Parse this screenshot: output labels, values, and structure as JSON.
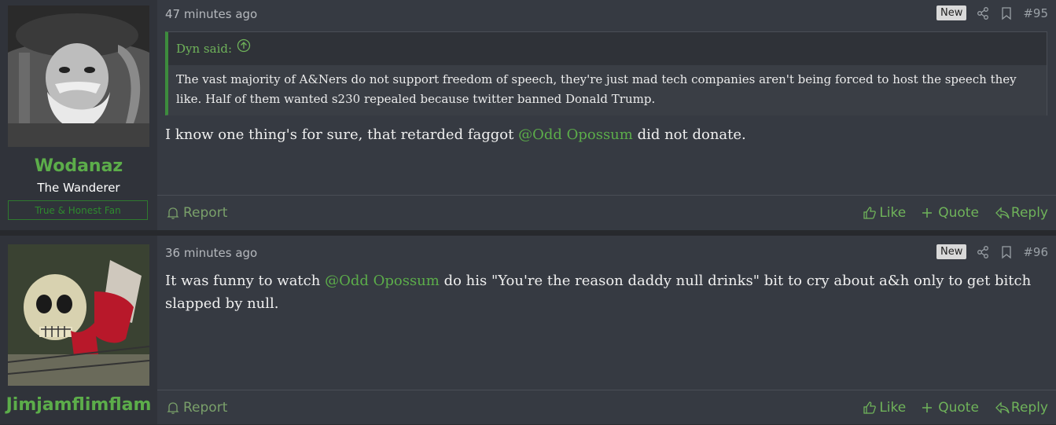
{
  "posts": [
    {
      "username": "Wodanaz",
      "user_title": "The Wanderer",
      "user_badge": "True & Honest Fan",
      "time": "47 minutes ago",
      "new_label": "New",
      "post_number": "#95",
      "quote": {
        "author": "Dyn said:",
        "text": "The vast majority of A&Ners do not support freedom of speech, they're just mad tech companies aren't being forced to host the speech they like. Half of them wanted s230 repealed because twitter banned Donald Trump."
      },
      "body_before": "I know one thing's for sure, that retarded faggot ",
      "mention": "@Odd Opossum",
      "body_after": " did not donate.",
      "report_label": "Report",
      "like_label": "Like",
      "quote_label": "Quote",
      "reply_label": "Reply"
    },
    {
      "username": "Jimjamflimflam",
      "time": "36 minutes ago",
      "new_label": "New",
      "post_number": "#96",
      "body_before": "It was funny to watch ",
      "mention": "@Odd Opossum",
      "body_after": " do his \"You're the reason daddy null drinks\" bit to cry about a&h only to get bitch slapped by null.",
      "report_label": "Report",
      "like_label": "Like",
      "quote_label": "Quote",
      "reply_label": "Reply"
    }
  ],
  "colors": {
    "accent": "#5cad4a",
    "background": "#363a42",
    "user_panel": "#30333a"
  },
  "icons": [
    "share-icon",
    "bookmark-icon",
    "bell-icon",
    "thumbs-up-icon",
    "plus-icon",
    "reply-icon",
    "arrow-up-circle-icon"
  ]
}
